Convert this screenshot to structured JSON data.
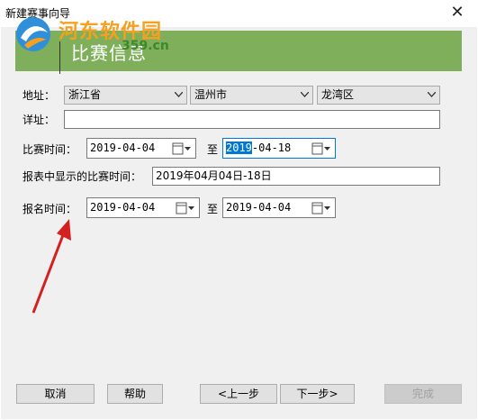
{
  "window": {
    "title": "新建赛事向导",
    "close_glyph": "✕"
  },
  "header": {
    "title": "比赛信息"
  },
  "watermark": {
    "name": "河东软件园",
    "url": "359.cn"
  },
  "address": {
    "label": "地址：",
    "province": "浙江省",
    "city": "温州市",
    "district": "龙湾区"
  },
  "detail": {
    "label": "详址：",
    "value": ""
  },
  "match_time": {
    "label": "比赛时间：",
    "start_date": "2019-04-04",
    "to_label": "至",
    "end_date_selected": "2019",
    "end_date_rest": "-04-18"
  },
  "report_time": {
    "label": "报表中显示的比赛时间：",
    "value": "2019年04月04日-18日"
  },
  "signup_time": {
    "label": "报名时间：",
    "start_date": "2019-04-04",
    "to_label": "至",
    "end_date": "2019-04-04"
  },
  "buttons": {
    "cancel": "取消",
    "help": "帮助",
    "prev": "<上一步",
    "next": "下一步>",
    "finish": "完成"
  },
  "icons": [
    "close-icon",
    "dropdown-arrow-icon",
    "calendar-icon",
    "logo-icon",
    "annotation-arrow-icon"
  ],
  "colors": {
    "banner": "#7faf5a",
    "selection": "#0078d7",
    "annotation_arrow": "#d42020"
  }
}
